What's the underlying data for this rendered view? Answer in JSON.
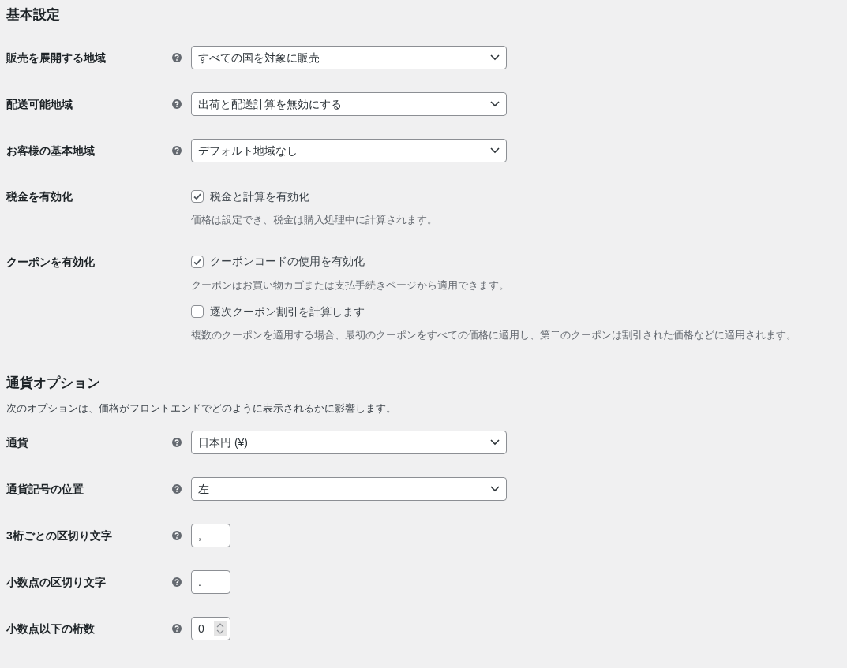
{
  "sections": [
    {
      "title": "基本設定",
      "rows": [
        {
          "kind": "select",
          "label": "販売を展開する地域",
          "help": true,
          "value": "すべての国を対象に販売"
        },
        {
          "kind": "select",
          "label": "配送可能地域",
          "help": true,
          "value": "出荷と配送計算を無効にする"
        },
        {
          "kind": "select",
          "label": "お客様の基本地域",
          "help": true,
          "value": "デフォルト地域なし"
        },
        {
          "kind": "checkboxes",
          "label": "税金を有効化",
          "help": false,
          "options": [
            {
              "label": "税金と計算を有効化",
              "checked": true,
              "description": "価格は設定でき、税金は購入処理中に計算されます。"
            }
          ]
        },
        {
          "kind": "checkboxes",
          "label": "クーポンを有効化",
          "help": false,
          "options": [
            {
              "label": "クーポンコードの使用を有効化",
              "checked": true,
              "description": "クーポンはお買い物カゴまたは支払手続きページから適用できます。"
            },
            {
              "label": "逐次クーポン割引を計算します",
              "checked": false,
              "description": "複数のクーポンを適用する場合、最初のクーポンをすべての価格に適用し、第二のクーポンは割引された価格などに適用されます。"
            }
          ]
        }
      ]
    },
    {
      "title": "通貨オプション",
      "description": "次のオプションは、価格がフロントエンドでどのように表示されるかに影響します。",
      "rows": [
        {
          "kind": "select",
          "label": "通貨",
          "help": true,
          "value": "日本円 (¥)"
        },
        {
          "kind": "select",
          "label": "通貨記号の位置",
          "help": true,
          "value": "左"
        },
        {
          "kind": "text",
          "label": "3桁ごとの区切り文字",
          "help": true,
          "value": ","
        },
        {
          "kind": "text",
          "label": "小数点の区切り文字",
          "help": true,
          "value": "."
        },
        {
          "kind": "number",
          "label": "小数点以下の桁数",
          "help": true,
          "value": "0"
        }
      ]
    }
  ]
}
